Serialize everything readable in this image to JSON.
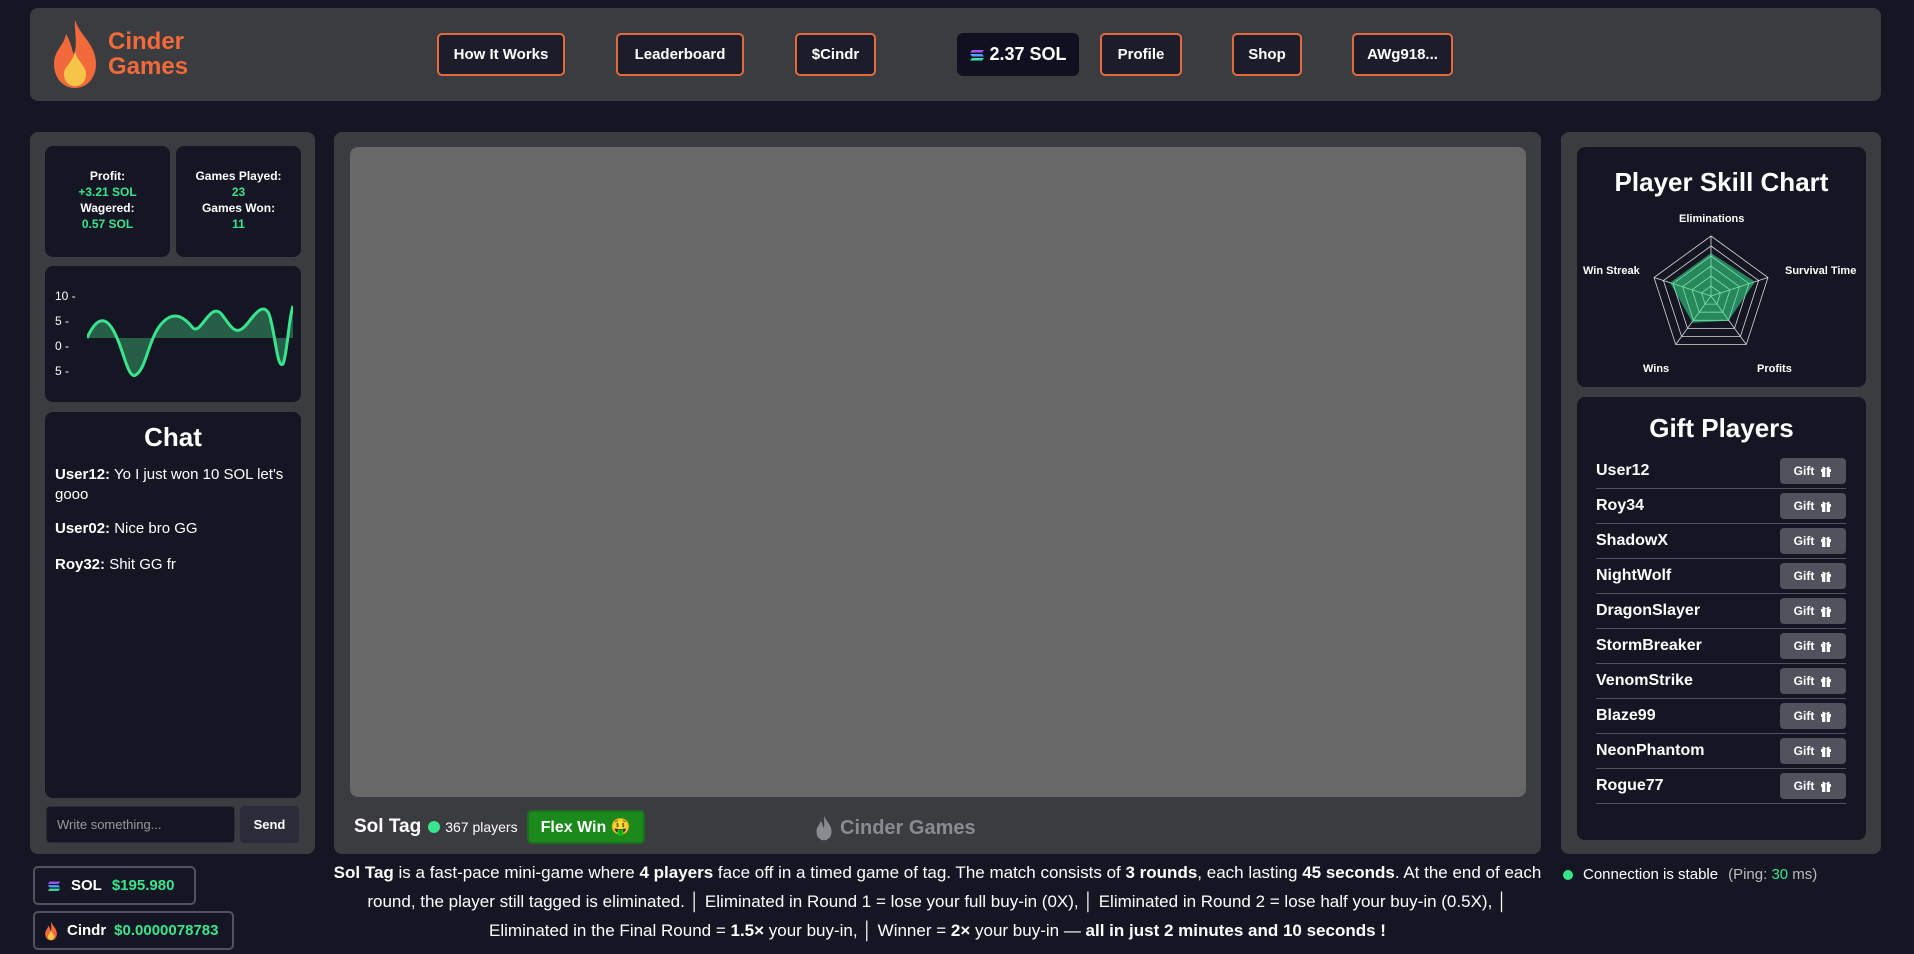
{
  "brand": {
    "name_line1": "Cinder",
    "name_line2": "Games",
    "accent": "#f26a3a"
  },
  "nav": {
    "how_it_works": "How It Works",
    "leaderboard": "Leaderboard",
    "cindr": "$Cindr",
    "sol_balance": "2.37 SOL",
    "profile": "Profile",
    "shop": "Shop",
    "wallet": "AWg918..."
  },
  "stats": {
    "profit_label": "Profit:",
    "profit_value": "+3.21 SOL",
    "wagered_label": "Wagered:",
    "wagered_value": "0.57 SOL",
    "games_played_label": "Games Played:",
    "games_played_value": "23",
    "games_won_label": "Games Won:",
    "games_won_value": "11"
  },
  "mini_chart": {
    "y_ticks": [
      "10 -",
      "5 -",
      "0 -",
      "5 -"
    ]
  },
  "chat": {
    "title": "Chat",
    "messages": [
      {
        "user": "User12:",
        "text": "Yo I just won 10 SOL let's gooo"
      },
      {
        "user": "User02:",
        "text": "Nice bro GG"
      },
      {
        "user": "Roy32:",
        "text": "Shit GG fr"
      }
    ],
    "input_placeholder": "Write something...",
    "send_label": "Send"
  },
  "wallets": {
    "sol_label": "SOL",
    "sol_amount": "$195.980",
    "cindr_label": "Cindr",
    "cindr_amount": "$0.0000078783"
  },
  "game": {
    "name": "Sol Tag",
    "players": "367 players",
    "flex_label": "Flex Win 🤑",
    "watermark": "Cinder Games"
  },
  "description": {
    "p1": "Sol Tag",
    "p2": " is a fast-pace mini-game where ",
    "p3": "4 players",
    "p4": " face off in a timed game of tag. The match consists of ",
    "p5": "3 rounds",
    "p6": ", each lasting ",
    "p7": "45 seconds",
    "p8": ". At the end of each round, the player still tagged is eliminated. │ Eliminated in Round 1 = lose your full buy-in (0X), │ Eliminated in Round 2 = lose half your buy-in (0.5X), │ Eliminated in the Final Round = ",
    "p9": "1.5×",
    "p10": " your buy-in, │ Winner = ",
    "p11": "2×",
    "p12": " your buy-in — ",
    "p13": "all in just 2 minutes and 10 seconds !"
  },
  "skill_chart": {
    "title": "Player Skill Chart",
    "axes": [
      "Eliminations",
      "Survival Time",
      "Profits",
      "Wins",
      "Win Streak"
    ]
  },
  "gift": {
    "title": "Gift Players",
    "button_label": "Gift",
    "players": [
      "User12",
      "Roy34",
      "ShadowX",
      "NightWolf",
      "DragonSlayer",
      "StormBreaker",
      "VenomStrike",
      "Blaze99",
      "NeonPhantom",
      "Rogue77"
    ]
  },
  "connection": {
    "status": "Connection is stable",
    "ping_prefix": "(Ping: ",
    "ping_value": "30",
    "ping_suffix": " ms)"
  }
}
